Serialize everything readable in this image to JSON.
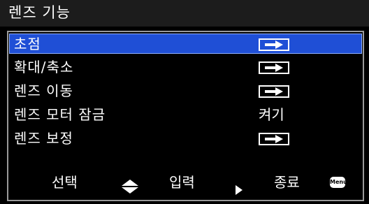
{
  "title": "렌즈 기능",
  "menu": {
    "items": [
      {
        "label": "초점",
        "value_type": "arrow",
        "value": ""
      },
      {
        "label": "확대/축소",
        "value_type": "arrow",
        "value": ""
      },
      {
        "label": "렌즈 이동",
        "value_type": "arrow",
        "value": ""
      },
      {
        "label": "렌즈 모터 잠금",
        "value_type": "text",
        "value": "켜기"
      },
      {
        "label": "렌즈 보정",
        "value_type": "arrow",
        "value": ""
      }
    ],
    "selected_index": 0
  },
  "footer": {
    "select_label": "선택",
    "select_icon": "up-down-arrows-icon",
    "enter_label": "입력",
    "enter_icon": "right-triangle-icon",
    "exit_label": "종료",
    "menu_key_label": "Menu"
  },
  "colors": {
    "selection": "#1f4fd6",
    "title_bar": "#1c1c1c",
    "border": "#9a9a9a",
    "text": "#ffffff"
  }
}
